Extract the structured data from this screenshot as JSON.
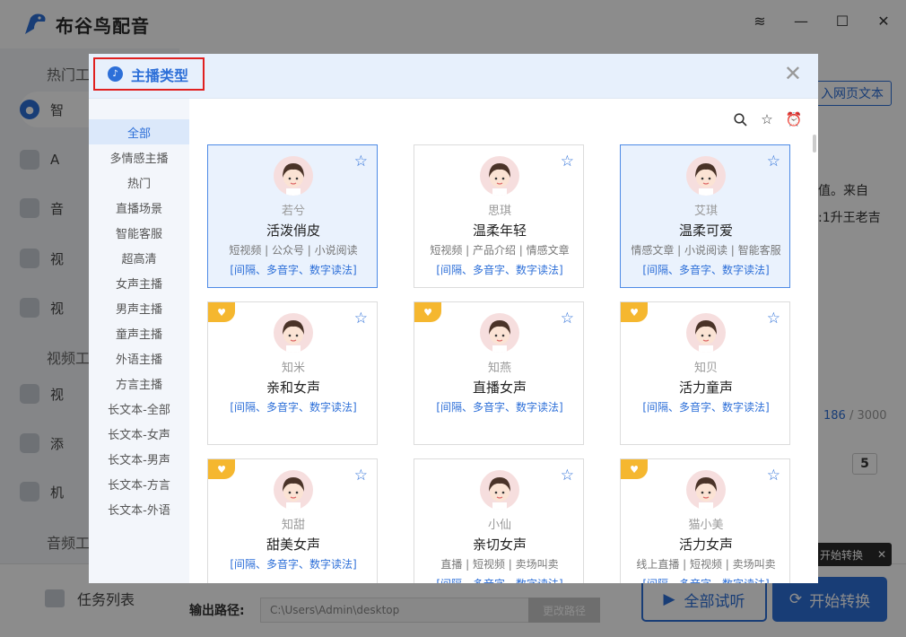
{
  "app": {
    "title": "布谷鸟配音"
  },
  "sidebar": {
    "sections": [
      "热门工",
      "视频工",
      "音频工"
    ],
    "items": [
      {
        "label": "智",
        "icon": "mic-icon"
      },
      {
        "label": "A",
        "icon": "person-ai-icon"
      },
      {
        "label": "音",
        "icon": "audio-icon"
      },
      {
        "label": "视",
        "icon": "video-icon"
      },
      {
        "label": "视",
        "icon": "video-voice-icon"
      },
      {
        "label": "视",
        "icon": "video-search-icon"
      },
      {
        "label": "添",
        "icon": "add-media-icon"
      },
      {
        "label": "机",
        "icon": "robot-icon"
      }
    ]
  },
  "main": {
    "import_btn": "入网页文本",
    "text_line1": "值。来自",
    "text_line2": ":1升王老吉",
    "char_count": "186",
    "char_max": "/ 3000",
    "speed_value": "5"
  },
  "bottom": {
    "task_list": "任务列表",
    "output_label": "输出路径:",
    "output_path": "C:\\Users\\Admin\\desktop",
    "change_path": "更改路径",
    "preview_all": "全部试听",
    "start_convert": "开始转换",
    "tooltip": "开始转换"
  },
  "modal": {
    "title": "主播类型",
    "categories": [
      "全部",
      "多情感主播",
      "热门",
      "直播场景",
      "智能客服",
      "超高清",
      "女声主播",
      "男声主播",
      "童声主播",
      "外语主播",
      "方言主播",
      "长文本-全部",
      "长文本-女声",
      "长文本-男声",
      "长文本-方言",
      "长文本-外语"
    ],
    "active_category": "全部",
    "cards": [
      {
        "name": "若兮",
        "title": "活泼俏皮",
        "tags": "短视频 | 公众号 | 小说阅读",
        "features": "[间隔、多音字、数字读法]",
        "selected": true,
        "vip": false
      },
      {
        "name": "思琪",
        "title": "温柔年轻",
        "tags": "短视频 | 产品介绍 | 情感文章",
        "features": "[间隔、多音字、数字读法]",
        "selected": false,
        "vip": false
      },
      {
        "name": "艾琪",
        "title": "温柔可爱",
        "tags": "情感文章 | 小说阅读 | 智能客服",
        "features": "[间隔、多音字、数字读法]",
        "selected": true,
        "vip": false
      },
      {
        "name": "知米",
        "title": "亲和女声",
        "tags": "",
        "features": "[间隔、多音字、数字读法]",
        "selected": false,
        "vip": true
      },
      {
        "name": "知燕",
        "title": "直播女声",
        "tags": "",
        "features": "[间隔、多音字、数字读法]",
        "selected": false,
        "vip": true
      },
      {
        "name": "知贝",
        "title": "活力童声",
        "tags": "",
        "features": "[间隔、多音字、数字读法]",
        "selected": false,
        "vip": true
      },
      {
        "name": "知甜",
        "title": "甜美女声",
        "tags": "",
        "features": "[间隔、多音字、数字读法]",
        "selected": false,
        "vip": true
      },
      {
        "name": "小仙",
        "title": "亲切女声",
        "tags": "直播 | 短视频 | 卖场叫卖",
        "features": "[间隔、多音字、数字读法]",
        "selected": false,
        "vip": false
      },
      {
        "name": "猫小美",
        "title": "活力女声",
        "tags": "线上直播 | 短视频 | 卖场叫卖",
        "features": "[间隔、多音字、数字读法]",
        "selected": false,
        "vip": true
      }
    ]
  },
  "colors": {
    "accent": "#2d6fd8",
    "vip": "#f5b72f",
    "highlight": "#e02020"
  }
}
